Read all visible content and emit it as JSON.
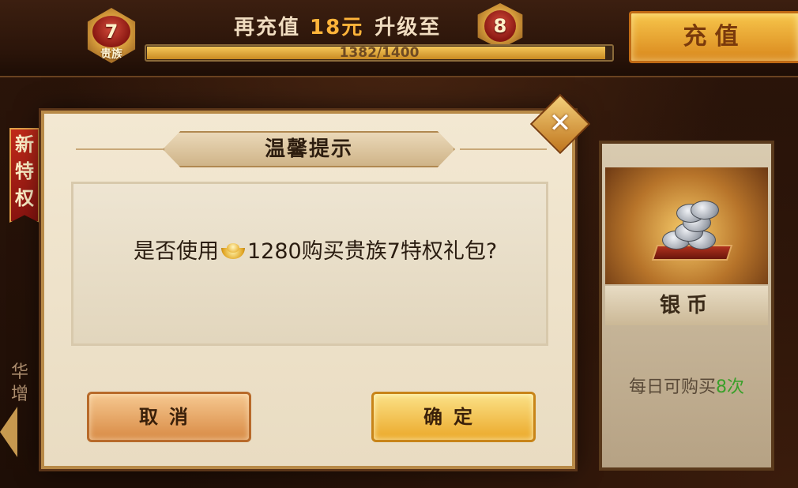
{
  "header": {
    "current_vip_level": "7",
    "current_vip_label": "贵族",
    "recharge_prefix": "再充值",
    "recharge_amount": "18元",
    "recharge_suffix": "升级至",
    "next_vip_level": "8",
    "progress_text": "1382/1400",
    "progress_fraction": 0.987,
    "recharge_button": "充值"
  },
  "left_panel": {
    "ribbon_chars": [
      "新",
      "特",
      "权"
    ],
    "partial_text_lines": [
      "华",
      "增"
    ]
  },
  "right_panel": {
    "item_name": "银币",
    "daily_prefix": "每日可购买",
    "daily_count": "8次",
    "item_icon": "silver-coins-icon"
  },
  "dialog": {
    "title": "温馨提示",
    "message_prefix": "是否使用",
    "currency_icon": "gold-ingot-icon",
    "message_suffix": "1280购买贵族7特权礼包?",
    "cancel_label": "取消",
    "confirm_label": "确定",
    "close_icon": "close-icon"
  },
  "colors": {
    "accent_gold": "#f5c85a",
    "amount_orange": "#ffb43a",
    "count_green": "#3aa02a",
    "ribbon_red": "#c12a1a"
  }
}
